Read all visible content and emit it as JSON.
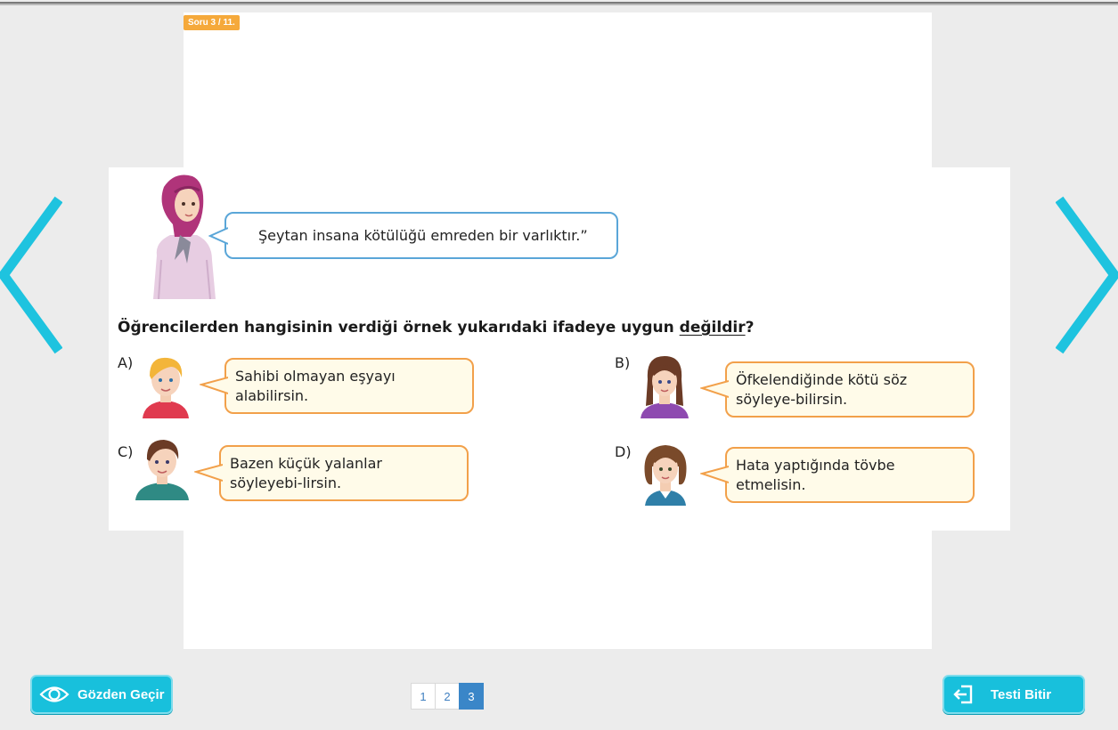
{
  "header": {
    "question_counter": "Soru 3 / 11."
  },
  "question": {
    "teacher_quote": "Şeytan insana kötülüğü emreden bir varlıktır.”",
    "prompt_before": "Öğrencilerden hangisinin verdiği örnek yukarıdaki ifadeye uygun ",
    "prompt_underlined": "değildir",
    "prompt_after": "?",
    "options": [
      {
        "letter": "A)",
        "text": "Sahibi olmayan eşyayı alabilirsin."
      },
      {
        "letter": "B)",
        "text": "Öfkelendiğinde kötü söz söyleye-bilirsin."
      },
      {
        "letter": "C)",
        "text": "Bazen küçük yalanlar söyleyebi-lirsin."
      },
      {
        "letter": "D)",
        "text": "Hata yaptığında tövbe etmelisin."
      }
    ]
  },
  "footer": {
    "review_label": "Gözden Geçir",
    "finish_label": "Testi Bitir",
    "pages": [
      "1",
      "2",
      "3"
    ],
    "current_page": "3"
  },
  "colors": {
    "accent": "#18c0dc",
    "arrow": "#1ec3df",
    "badge": "#f5a93b",
    "bubble_border": "#f2a04a",
    "bubble_fill": "#fffbe9",
    "teacher_bubble_border": "#5aa6d8",
    "pager_active": "#3a86c8"
  },
  "icons": {
    "prev": "chevron-left-icon",
    "next": "chevron-right-icon",
    "review": "eye-icon",
    "finish": "exit-icon"
  }
}
